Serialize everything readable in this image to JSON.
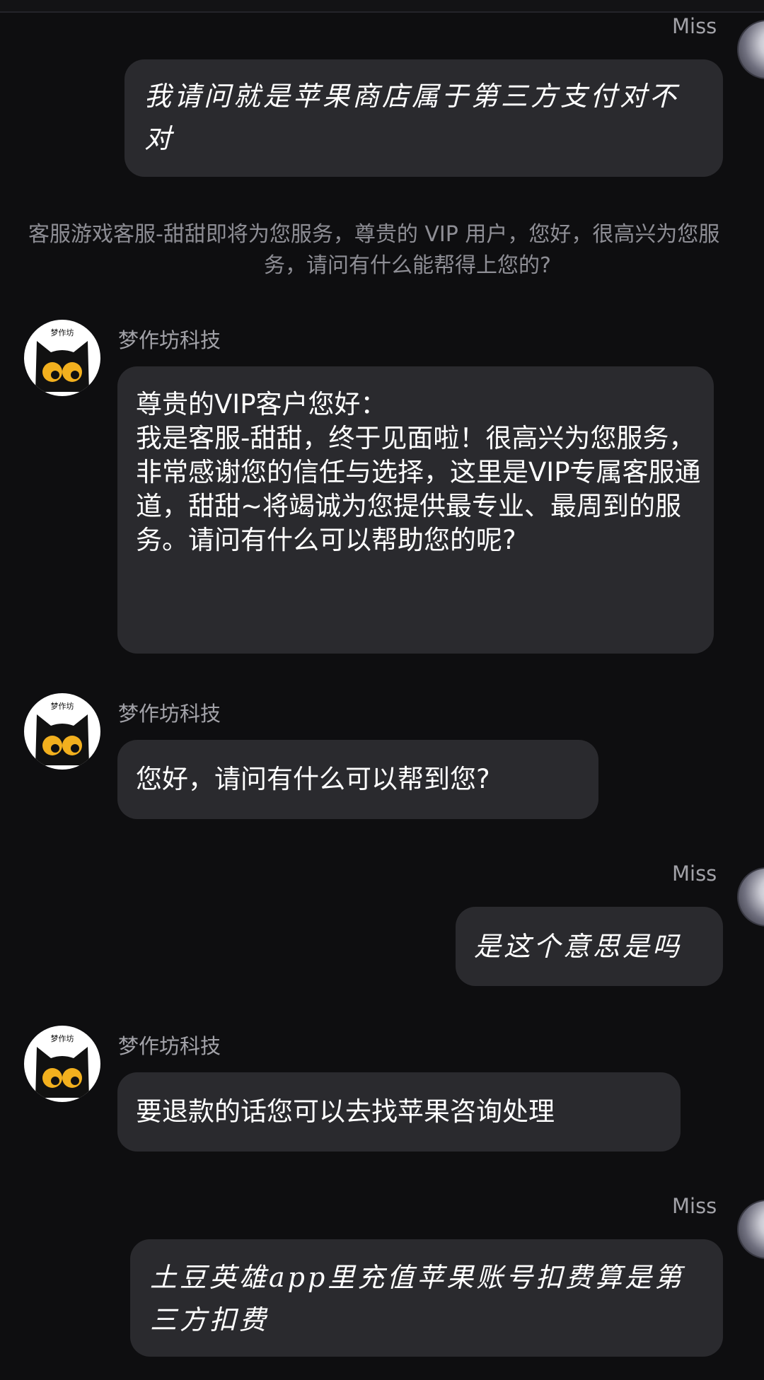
{
  "chat": {
    "user_name": "Miss",
    "bot_name": "梦作坊科技",
    "avatar_badge": "梦作坊",
    "system_line1": "客服游戏客服-甜甜即将为您服务，尊贵的 VIP 用户，您好，很高兴为您服",
    "system_line2": "务，请问有什么能帮得上您的?",
    "messages": [
      {
        "from": "user",
        "text": "我请问就是苹果商店属于第三方支付对不对"
      },
      {
        "from": "bot",
        "text": "尊贵的VIP客户您好：\n我是客服-甜甜，终于见面啦！很高兴为您服务，非常感谢您的信任与选择，这里是VIP专属客服通道，甜甜~将竭诚为您提供最专业、最周到的服务。请问有什么可以帮助您的呢?"
      },
      {
        "from": "bot",
        "text": "您好，请问有什么可以帮到您?"
      },
      {
        "from": "user",
        "text": "是这个意思是吗"
      },
      {
        "from": "bot",
        "text": "要退款的话您可以去找苹果咨询处理"
      },
      {
        "from": "user",
        "text": "土豆英雄app里充值苹果账号扣费算是第三方扣费"
      }
    ]
  },
  "colors": {
    "background": "#0e0e10",
    "bubble": "#2a2a2e",
    "name_text": "#a2a2a8",
    "system_text": "#8e8e95",
    "cat_eye": "#f2b01e"
  },
  "icons": {
    "bot_avatar": "black-cat-avatar",
    "user_avatar": "user-avatar"
  }
}
